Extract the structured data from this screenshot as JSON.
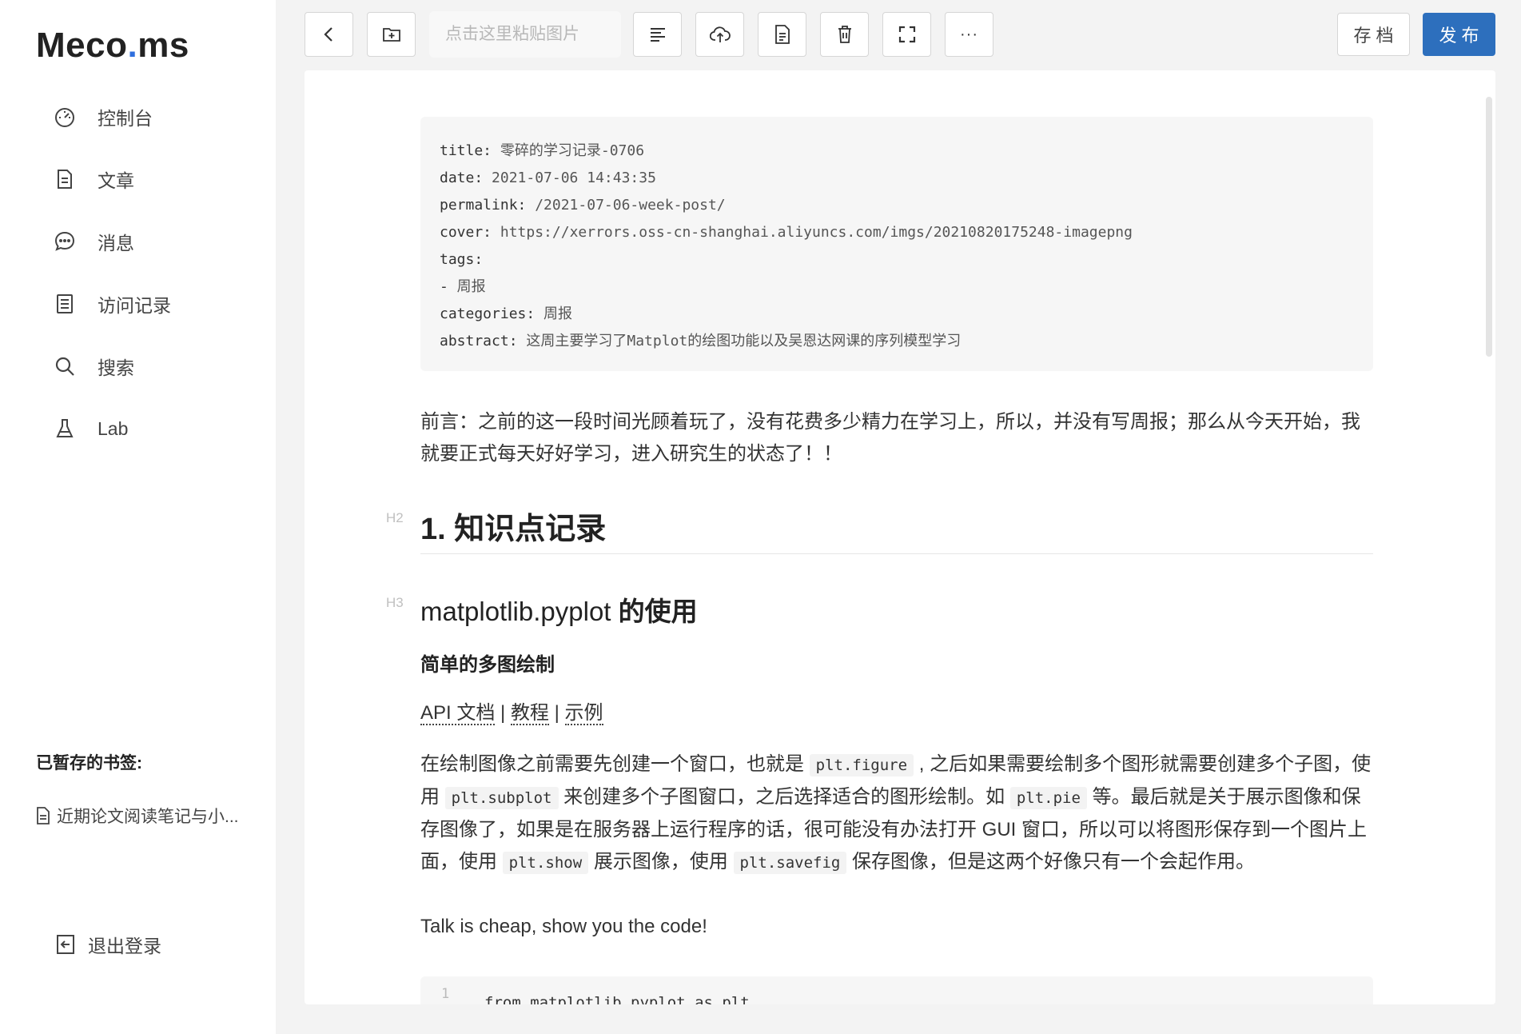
{
  "brand": {
    "part1": "Meco",
    "dot": ".",
    "part2": "ms"
  },
  "sidebar": {
    "items": [
      {
        "label": "控制台",
        "icon": "dashboard-icon"
      },
      {
        "label": "文章",
        "icon": "document-icon"
      },
      {
        "label": "消息",
        "icon": "message-icon"
      },
      {
        "label": "访问记录",
        "icon": "access-log-icon"
      },
      {
        "label": "搜索",
        "icon": "search-icon"
      },
      {
        "label": "Lab",
        "icon": "flask-icon"
      }
    ],
    "bookmarks_title": "已暂存的书签:",
    "bookmarks": [
      {
        "label": "近期论文阅读笔记与小..."
      }
    ],
    "logout_label": "退出登录"
  },
  "toolbar": {
    "paste_placeholder": "点击这里粘贴图片",
    "more_label": "···",
    "save_label": "存档",
    "publish_label": "发布",
    "icons": [
      "back-icon",
      "new-folder-icon",
      "outline-icon",
      "upload-icon",
      "file-icon",
      "delete-icon",
      "fullscreen-icon",
      "more-icon"
    ]
  },
  "front_matter": [
    {
      "key": "title:",
      "value": " 零碎的学习记录-0706"
    },
    {
      "key": "date:",
      "value": " 2021-07-06 14:43:35"
    },
    {
      "key": "permalink:",
      "value": " /2021-07-06-week-post/"
    },
    {
      "key": "cover:",
      "value": " https://xerrors.oss-cn-shanghai.aliyuncs.com/imgs/20210820175248-imagepng"
    },
    {
      "key": "tags:",
      "value": ""
    },
    {
      "key": "-",
      "value": " 周报"
    },
    {
      "key": "categories:",
      "value": " 周报"
    },
    {
      "key": "abstract:",
      "value": " 这周主要学习了Matplot的绘图功能以及吴恩达网课的序列模型学习"
    }
  ],
  "content": {
    "intro": "前言：之前的这一段时间光顾着玩了，没有花费多少精力在学习上，所以，并没有写周报；那么从今天开始，我就要正式每天好好学习，进入研究生的状态了！！",
    "h2_label": "H2",
    "h2": "1. 知识点记录",
    "h3_label": "H3",
    "h3_code": "matplotlib.pyplot",
    "h3_text": " 的使用",
    "h4": "简单的多图绘制",
    "links": [
      "API 文档",
      "教程",
      "示例"
    ],
    "link_sep": " | ",
    "para_parts": [
      "在绘制图像之前需要先创建一个窗口，也就是 ",
      "plt.figure",
      " , 之后如果需要绘制多个图形就需要创建多个子图，使用 ",
      "plt.subplot",
      " 来创建多个子图窗口，之后选择适合的图形绘制。如 ",
      "plt.pie",
      " 等。最后就是关于展示图像和保存图像了，如果是在服务器上运行程序的话，很可能没有办法打开 GUI 窗口，所以可以将图形保存到一个图片上面，使用 ",
      "plt.show",
      " 展示图像，使用 ",
      "plt.savefig",
      " 保存图像，但是这两个好像只有一个会起作用。"
    ],
    "talk": "Talk is cheap, show you the code!",
    "code_line_no": "1",
    "code_line": "from matplotlib.pyplot as plt"
  }
}
